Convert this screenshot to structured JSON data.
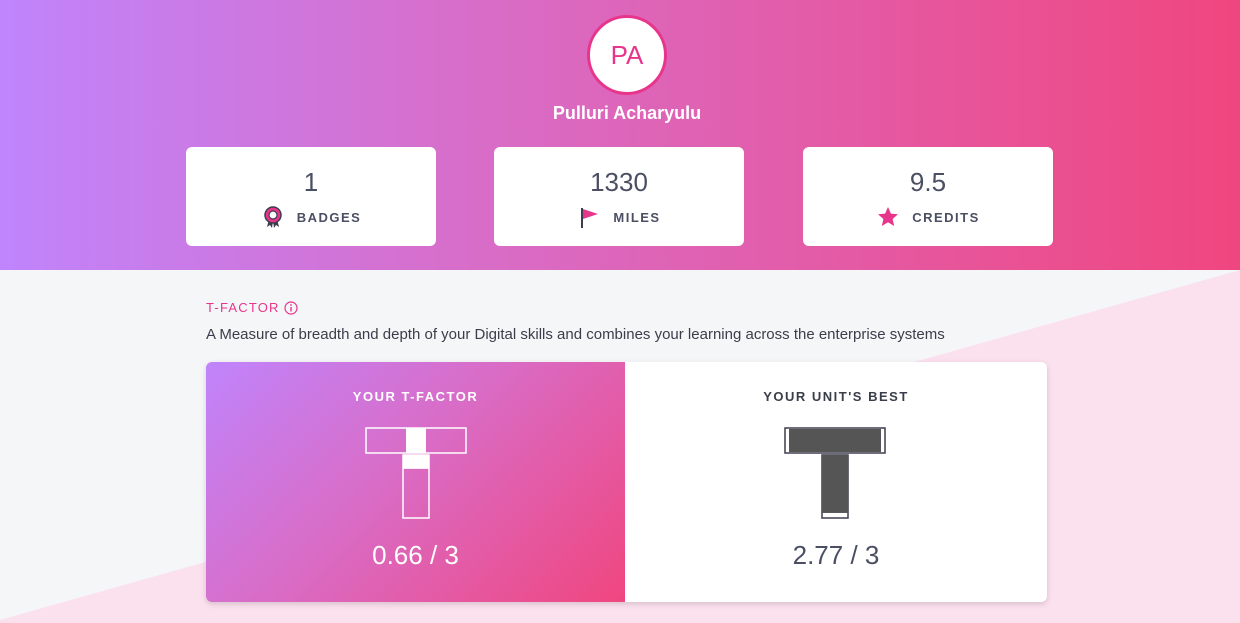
{
  "profile": {
    "initials": "PA",
    "name": "Pulluri Acharyulu"
  },
  "stats": [
    {
      "value": "1",
      "label": "BADGES",
      "icon": "badge-ribbon-icon"
    },
    {
      "value": "1330",
      "label": "MILES",
      "icon": "flag-icon"
    },
    {
      "value": "9.5",
      "label": "CREDITS",
      "icon": "star-icon"
    }
  ],
  "tfactor": {
    "title": "T-FACTOR",
    "info_icon": "info-icon",
    "description": "A Measure of breadth and depth of your Digital skills and combines your learning across the enterprise systems",
    "yours": {
      "heading": "YOUR T-FACTOR",
      "score": "0.66 / 3",
      "breadth_fill": 0.2,
      "depth_fill": 0.22
    },
    "unit_best": {
      "heading": "YOUR UNIT'S BEST",
      "score": "2.77 / 3",
      "breadth_fill": 0.92,
      "depth_fill": 0.92
    }
  },
  "colors": {
    "accent": "#e8358c",
    "gradient_start": "#c084fc",
    "gradient_end": "#f0467f",
    "text_dark": "#4a4f63",
    "bar_dark": "#555555"
  }
}
